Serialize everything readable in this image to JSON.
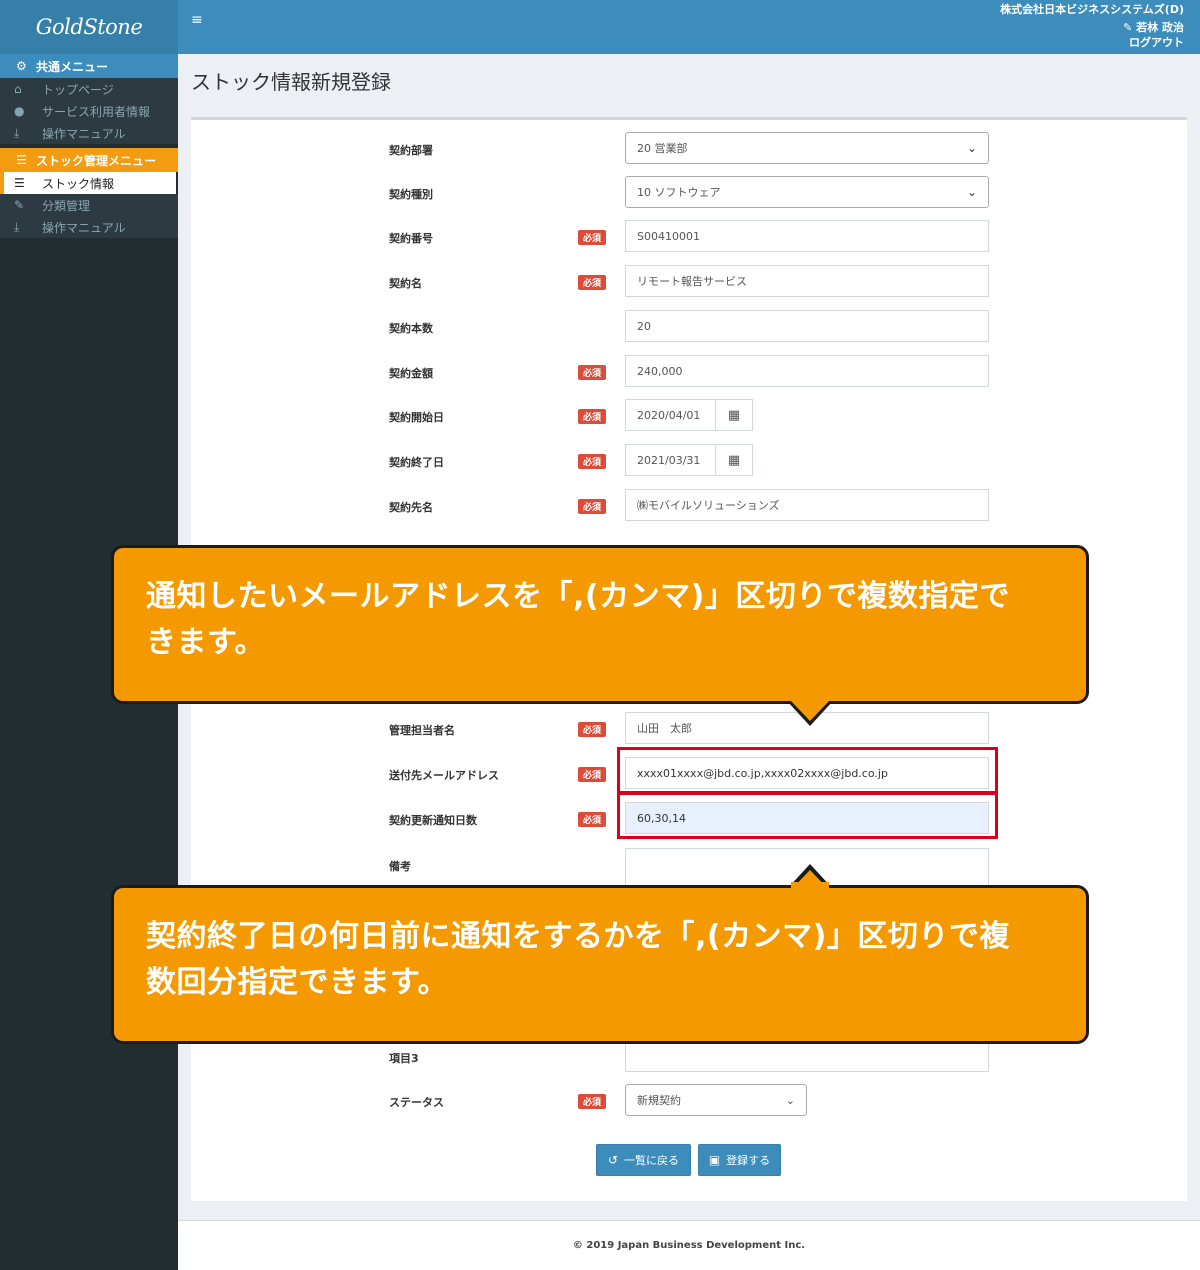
{
  "app": {
    "logo": "GoldStone"
  },
  "topbar": {
    "company": "株式会社日本ビジネスシステムズ(D)",
    "user": "若林 政治",
    "logout": "ログアウト"
  },
  "sidebar": {
    "common_header": "共通メニュー",
    "common_items": [
      {
        "label": "トップページ",
        "icon": "home-icon"
      },
      {
        "label": "サービス利用者情報",
        "icon": "users-icon"
      },
      {
        "label": "操作マニュアル",
        "icon": "download-icon"
      }
    ],
    "stock_header": "ストック管理メニュー",
    "stock_items": [
      {
        "label": "ストック情報",
        "icon": "list-icon",
        "active": true
      },
      {
        "label": "分類管理",
        "icon": "wrench-icon"
      },
      {
        "label": "操作マニュアル",
        "icon": "download-icon"
      }
    ]
  },
  "page": {
    "title": "ストック情報新規登録"
  },
  "required_label": "必須",
  "form": {
    "dept": {
      "label": "契約部署",
      "value": "20 営業部"
    },
    "type": {
      "label": "契約種別",
      "value": "10 ソフトウェア"
    },
    "number": {
      "label": "契約番号",
      "value": "S00410001"
    },
    "name": {
      "label": "契約名",
      "value": "リモート報告サービス"
    },
    "count": {
      "label": "契約本数",
      "value": "20"
    },
    "amount": {
      "label": "契約金額",
      "value": "240,000"
    },
    "start": {
      "label": "契約開始日",
      "value": "2020/04/01"
    },
    "end": {
      "label": "契約終了日",
      "value": "2021/03/31"
    },
    "partner": {
      "label": "契約先名",
      "value": "㈱モバイルソリューションズ"
    },
    "manager": {
      "label": "管理担当者名",
      "value": "山田　太郎"
    },
    "email": {
      "label": "送付先メールアドレス",
      "value": "xxxx01xxxx@jbd.co.jp,xxxx02xxxx@jbd.co.jp"
    },
    "notify_days": {
      "label": "契約更新通知日数",
      "value": "60,30,14"
    },
    "remarks": {
      "label": "備考",
      "value": ""
    },
    "item3": {
      "label": "項目3",
      "value": ""
    },
    "status": {
      "label": "ステータス",
      "value": "新規契約"
    }
  },
  "buttons": {
    "back": "一覧に戻る",
    "register": "登録する"
  },
  "callouts": {
    "email_note_line1": "通知したいメールアドレスを「,(カンマ)」区切りで複数指定で",
    "email_note_line2": "きます。",
    "days_note_line1": "契約終了日の何日前に通知をするかを「,(カンマ)」区切りで複",
    "days_note_line2": "数回分指定できます。"
  },
  "footer": {
    "copyright": "© 2019 Japan Business Development Inc."
  },
  "colors": {
    "header_blue": "#3c8dbc",
    "logo_blue": "#367fa9",
    "sidebar_dark": "#222d32",
    "accent_orange": "#f39c12",
    "callout_orange": "#f49a00",
    "required_red": "#dd4b39",
    "highlight_red": "#d9001b"
  }
}
